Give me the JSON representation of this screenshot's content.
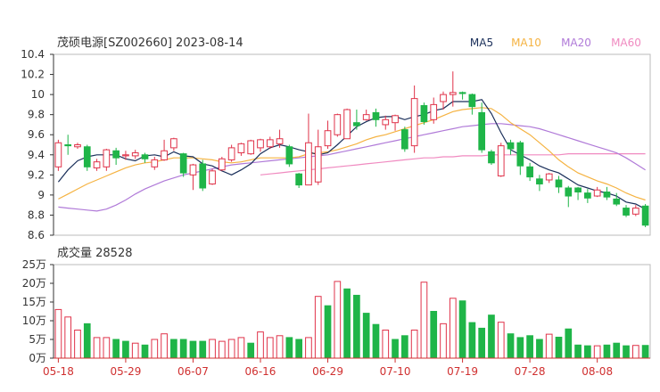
{
  "header": {
    "title": "茂硕电源[SZ002660] 2023-08-14"
  },
  "legend": [
    {
      "label": "MA5",
      "color": "#1a2f5a"
    },
    {
      "label": "MA10",
      "color": "#f5b342"
    },
    {
      "label": "MA20",
      "color": "#b07ad8"
    },
    {
      "label": "MA60",
      "color": "#f08ac0"
    }
  ],
  "colors": {
    "up": "#e0334a",
    "down": "#1fb548",
    "axis": "#333333",
    "grid": "#dddddd",
    "date": "#d03030"
  },
  "volume_panel": {
    "label": "成交量 28528"
  },
  "chart_data": [
    {
      "type": "candlestick",
      "title": "茂硕电源[SZ002660] 2023-08-14",
      "ylim": [
        8.6,
        10.4
      ],
      "yticks": [
        "10.4",
        "10.2",
        "10",
        "9.8",
        "9.6",
        "9.4",
        "9.2",
        "9",
        "8.8",
        "8.6"
      ],
      "yvalues": [
        10.4,
        10.2,
        10.0,
        9.8,
        9.6,
        9.4,
        9.2,
        9.0,
        8.8,
        8.6
      ],
      "xtick_labels": [
        "05-18",
        "05-29",
        "06-07",
        "06-16",
        "06-29",
        "07-10",
        "07-19",
        "07-28",
        "08-08"
      ],
      "xtick_index": [
        0,
        7,
        14,
        21,
        28,
        35,
        42,
        49,
        56
      ],
      "candles": [
        [
          9.28,
          9.52,
          9.24,
          9.55
        ],
        [
          9.5,
          9.49,
          9.4,
          9.6
        ],
        [
          9.48,
          9.5,
          9.46,
          9.52
        ],
        [
          9.48,
          9.28,
          9.24,
          9.5
        ],
        [
          9.27,
          9.33,
          9.24,
          9.36
        ],
        [
          9.28,
          9.45,
          9.24,
          9.46
        ],
        [
          9.44,
          9.37,
          9.3,
          9.47
        ],
        [
          9.39,
          9.4,
          9.35,
          9.44
        ],
        [
          9.39,
          9.42,
          9.36,
          9.45
        ],
        [
          9.4,
          9.36,
          9.32,
          9.42
        ],
        [
          9.28,
          9.35,
          9.25,
          9.38
        ],
        [
          9.35,
          9.44,
          9.34,
          9.55
        ],
        [
          9.47,
          9.56,
          9.44,
          9.57
        ],
        [
          9.41,
          9.22,
          9.18,
          9.42
        ],
        [
          9.2,
          9.3,
          9.05,
          9.31
        ],
        [
          9.31,
          9.07,
          9.04,
          9.35
        ],
        [
          9.11,
          9.24,
          9.1,
          9.26
        ],
        [
          9.25,
          9.36,
          9.24,
          9.38
        ],
        [
          9.35,
          9.47,
          9.33,
          9.5
        ],
        [
          9.42,
          9.51,
          9.39,
          9.52
        ],
        [
          9.41,
          9.54,
          9.4,
          9.55
        ],
        [
          9.47,
          9.55,
          9.43,
          9.56
        ],
        [
          9.48,
          9.55,
          9.46,
          9.58
        ],
        [
          9.51,
          9.56,
          9.47,
          9.65
        ],
        [
          9.48,
          9.31,
          9.28,
          9.5
        ],
        [
          9.21,
          9.1,
          9.07,
          9.22
        ],
        [
          9.1,
          9.52,
          9.1,
          9.81
        ],
        [
          9.13,
          9.48,
          9.1,
          9.65
        ],
        [
          9.49,
          9.64,
          9.46,
          9.74
        ],
        [
          9.6,
          9.8,
          9.58,
          9.81
        ],
        [
          9.56,
          9.85,
          9.56,
          9.86
        ],
        [
          9.72,
          9.69,
          9.65,
          9.85
        ],
        [
          9.75,
          9.8,
          9.74,
          9.85
        ],
        [
          9.82,
          9.75,
          9.68,
          9.86
        ],
        [
          9.7,
          9.75,
          9.65,
          9.79
        ],
        [
          9.72,
          9.79,
          9.64,
          9.8
        ],
        [
          9.65,
          9.46,
          9.43,
          9.68
        ],
        [
          9.49,
          9.96,
          9.42,
          10.09
        ],
        [
          9.89,
          9.73,
          9.7,
          9.92
        ],
        [
          9.75,
          9.9,
          9.71,
          9.97
        ],
        [
          9.93,
          10.0,
          9.85,
          10.03
        ],
        [
          10.0,
          10.02,
          9.88,
          10.23
        ],
        [
          10.02,
          10.01,
          9.95,
          10.03
        ],
        [
          10.0,
          9.88,
          9.8,
          10.01
        ],
        [
          9.82,
          9.45,
          9.42,
          9.92
        ],
        [
          9.43,
          9.32,
          9.3,
          9.45
        ],
        [
          9.19,
          9.49,
          9.18,
          9.52
        ],
        [
          9.52,
          9.46,
          9.4,
          9.55
        ],
        [
          9.52,
          9.29,
          9.2,
          9.54
        ],
        [
          9.28,
          9.18,
          9.14,
          9.32
        ],
        [
          9.16,
          9.11,
          9.04,
          9.2
        ],
        [
          9.15,
          9.21,
          9.12,
          9.22
        ],
        [
          9.15,
          9.08,
          9.02,
          9.19
        ],
        [
          9.07,
          8.99,
          8.88,
          9.09
        ],
        [
          9.07,
          9.03,
          8.95,
          9.08
        ],
        [
          9.02,
          8.97,
          8.92,
          9.06
        ],
        [
          8.99,
          9.05,
          8.98,
          9.08
        ],
        [
          9.03,
          8.98,
          8.95,
          9.08
        ],
        [
          8.96,
          8.91,
          8.89,
          9.02
        ],
        [
          8.87,
          8.8,
          8.78,
          8.9
        ],
        [
          8.81,
          8.87,
          8.79,
          8.9
        ],
        [
          8.89,
          8.7,
          8.68,
          8.91
        ]
      ],
      "candle_fields": [
        "open",
        "close",
        "low",
        "high"
      ],
      "ma5": [
        9.13,
        9.25,
        9.34,
        9.38,
        9.4,
        9.4,
        9.4,
        9.36,
        9.34,
        9.39,
        9.4,
        9.38,
        9.43,
        9.39,
        9.38,
        9.31,
        9.29,
        9.24,
        9.2,
        9.25,
        9.31,
        9.41,
        9.47,
        9.5,
        9.48,
        9.45,
        9.43,
        9.4,
        9.42,
        9.5,
        9.59,
        9.68,
        9.73,
        9.77,
        9.78,
        9.78,
        9.75,
        9.78,
        9.8,
        9.84,
        9.86,
        9.93,
        9.93,
        9.93,
        9.95,
        9.81,
        9.62,
        9.45,
        9.4,
        9.35,
        9.29,
        9.25,
        9.22,
        9.16,
        9.1,
        9.07,
        9.04,
        9.02,
        8.99,
        8.93,
        8.91,
        8.86
      ],
      "ma10": [
        8.96,
        9.01,
        9.06,
        9.11,
        9.15,
        9.19,
        9.23,
        9.27,
        9.3,
        9.32,
        9.33,
        9.35,
        9.37,
        9.37,
        9.37,
        9.36,
        9.35,
        9.33,
        9.32,
        9.33,
        9.35,
        9.37,
        9.37,
        9.37,
        9.37,
        9.38,
        9.41,
        9.42,
        9.43,
        9.45,
        9.48,
        9.51,
        9.55,
        9.58,
        9.6,
        9.63,
        9.66,
        9.69,
        9.72,
        9.75,
        9.79,
        9.83,
        9.85,
        9.86,
        9.87,
        9.86,
        9.8,
        9.72,
        9.66,
        9.6,
        9.52,
        9.44,
        9.35,
        9.28,
        9.22,
        9.18,
        9.14,
        9.11,
        9.07,
        9.02,
        8.98,
        8.95
      ],
      "ma20": [
        8.88,
        8.87,
        8.86,
        8.85,
        8.84,
        8.86,
        8.9,
        8.95,
        9.01,
        9.06,
        9.1,
        9.14,
        9.17,
        9.2,
        9.22,
        9.24,
        9.26,
        9.28,
        9.3,
        9.31,
        9.32,
        9.33,
        9.34,
        9.35,
        9.36,
        9.37,
        9.38,
        9.39,
        9.4,
        9.42,
        9.44,
        9.46,
        9.48,
        9.5,
        9.52,
        9.54,
        9.56,
        9.58,
        9.6,
        9.62,
        9.64,
        9.66,
        9.68,
        9.69,
        9.7,
        9.71,
        9.71,
        9.7,
        9.69,
        9.68,
        9.66,
        9.63,
        9.6,
        9.57,
        9.54,
        9.51,
        9.48,
        9.45,
        9.42,
        9.37,
        9.31,
        9.25
      ],
      "ma60": [
        null,
        null,
        null,
        null,
        null,
        null,
        null,
        null,
        null,
        null,
        null,
        null,
        null,
        null,
        null,
        null,
        null,
        null,
        null,
        null,
        null,
        9.2,
        9.21,
        9.22,
        9.23,
        9.24,
        9.25,
        9.26,
        9.27,
        9.28,
        9.29,
        9.3,
        9.31,
        9.32,
        9.33,
        9.34,
        9.35,
        9.36,
        9.37,
        9.37,
        9.38,
        9.38,
        9.39,
        9.39,
        9.39,
        9.4,
        9.4,
        9.4,
        9.4,
        9.4,
        9.4,
        9.4,
        9.4,
        9.41,
        9.41,
        9.41,
        9.41,
        9.41,
        9.41,
        9.41,
        9.41,
        9.41
      ]
    },
    {
      "type": "bar",
      "title": "成交量 28528",
      "unit": "万",
      "ylim": [
        0,
        25
      ],
      "yticks": [
        "25万",
        "20万",
        "15万",
        "10万",
        "5万",
        "0万"
      ],
      "yvalues": [
        25,
        20,
        15,
        10,
        5,
        0
      ],
      "values": [
        13.0,
        11.0,
        7.5,
        9.2,
        5.5,
        5.5,
        5.0,
        4.5,
        4.0,
        3.5,
        5.0,
        6.5,
        5.0,
        5.0,
        4.5,
        4.5,
        5.0,
        4.5,
        5.0,
        5.5,
        4.0,
        7.0,
        5.5,
        6.0,
        5.5,
        5.0,
        5.5,
        16.5,
        14.0,
        20.5,
        18.5,
        16.8,
        12.0,
        9.0,
        7.5,
        5.0,
        6.0,
        7.5,
        20.3,
        12.5,
        9.2,
        16.0,
        15.3,
        9.5,
        8.0,
        11.5,
        9.6,
        6.5,
        5.5,
        6.0,
        5.0,
        6.4,
        5.6,
        7.8,
        3.5,
        3.3,
        3.3,
        3.5,
        4.0,
        3.3,
        3.4,
        3.4
      ],
      "up": [
        true,
        true,
        true,
        false,
        true,
        true,
        false,
        false,
        true,
        false,
        true,
        true,
        false,
        false,
        false,
        false,
        true,
        true,
        true,
        true,
        false,
        true,
        true,
        true,
        false,
        false,
        true,
        true,
        false,
        true,
        false,
        false,
        false,
        false,
        true,
        false,
        false,
        true,
        true,
        false,
        true,
        true,
        false,
        false,
        false,
        false,
        true,
        false,
        false,
        false,
        false,
        true,
        false,
        false,
        false,
        false,
        true,
        false,
        false,
        false,
        true,
        false
      ]
    }
  ]
}
